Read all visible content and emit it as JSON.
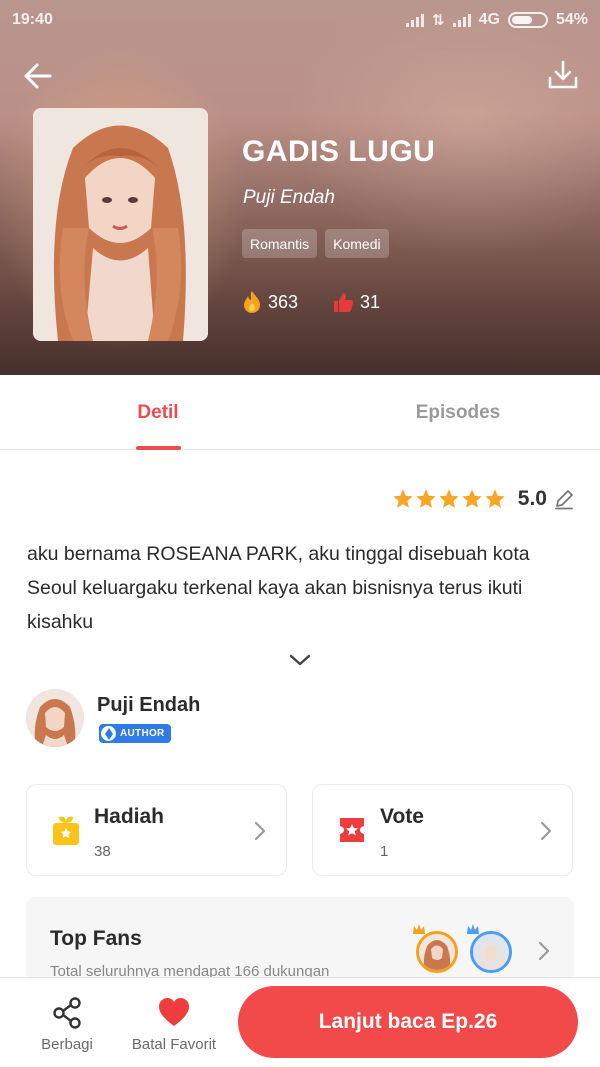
{
  "statusbar": {
    "time": "19:40",
    "network": "4G",
    "battery": "54%"
  },
  "book": {
    "title": "GADIS LUGU",
    "author": "Puji Endah",
    "tags": [
      "Romantis",
      "Komedi"
    ],
    "stats": {
      "views": "363",
      "likes": "31"
    },
    "rating": {
      "value": "5.0",
      "stars": 5
    },
    "synopsis": "aku bernama ROSEANA PARK, aku tinggal disebuah kota Seoul keluargaku terkenal kaya akan bisnisnya terus ikuti kisahku"
  },
  "tabs": [
    {
      "label": "Detil",
      "active": true
    },
    {
      "label": "Episodes",
      "active": false
    }
  ],
  "author": {
    "name": "Puji Endah",
    "badge": "AUTHOR"
  },
  "cards": {
    "gift": {
      "title": "Hadiah",
      "count": "38"
    },
    "vote": {
      "title": "Vote",
      "count": "1"
    }
  },
  "topfans": {
    "title": "Top Fans",
    "subtitle": "Total seluruhnya mendapat 166 dukungan"
  },
  "bottombar": {
    "share_label": "Berbagi",
    "favorite_label": "Batal Favorit",
    "read_button": "Lanjut baca Ep.26"
  },
  "colors": {
    "accent": "#ef4b4b",
    "badge_blue": "#2f7be6",
    "star": "#f5a623"
  },
  "icons": {
    "back": "arrow-left-icon",
    "download": "download-icon",
    "views": "fire-icon",
    "likes": "thumbs-up-icon",
    "edit": "pencil-icon",
    "expand": "chevron-down-icon",
    "gift": "gift-icon",
    "vote": "ticket-icon",
    "share": "share-icon",
    "favorite": "heart-icon"
  }
}
